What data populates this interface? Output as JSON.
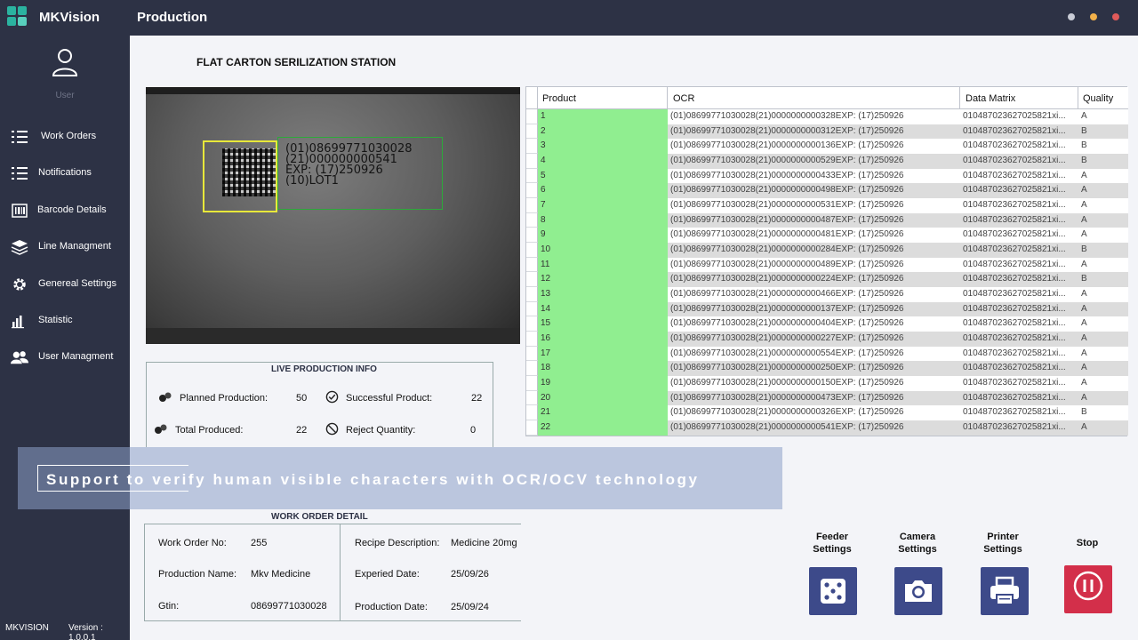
{
  "app": {
    "name": "MKVision",
    "page_title": "Production"
  },
  "window_controls": {
    "colors": [
      "#c9ccd6",
      "#f2b14a",
      "#e05a5a"
    ]
  },
  "sidebar": {
    "user_label": "User",
    "items": [
      {
        "label": "Work Orders",
        "icon": "list-icon"
      },
      {
        "label": "Notifications",
        "icon": "list-icon"
      },
      {
        "label": "Barcode Details",
        "icon": "barcode-icon"
      },
      {
        "label": "Line Managment",
        "icon": "layers-icon"
      },
      {
        "label": "Genereal Settings",
        "icon": "gear-icon"
      },
      {
        "label": "Statistic",
        "icon": "bar-chart-icon"
      },
      {
        "label": "User Managment",
        "icon": "users-icon"
      }
    ],
    "footer_brand": "MKVISION",
    "version": "Version : 1.0.0.1"
  },
  "station_title": "FLAT CARTON SERILIZATION STATION",
  "camera": {
    "lines": [
      "(01)08699771030028",
      "(21)000000000541",
      "EXP: (17)250926",
      "(10)LOT1"
    ]
  },
  "live_info": {
    "title": "LIVE PRODUCTION INFO",
    "planned_label": "Planned Production:",
    "planned_value": "50",
    "successful_label": "Successful Product:",
    "successful_value": "22",
    "total_label": "Total Produced:",
    "total_value": "22",
    "reject_label": "Reject Quantity:",
    "reject_value": "0"
  },
  "banner": {
    "text": "Support to verify human visible characters with OCR/OCV technology"
  },
  "table": {
    "headers": [
      "Product",
      "OCR",
      "Data Matrix",
      "Quality"
    ],
    "rows": [
      {
        "n": "1",
        "ocr": "(01)08699771030028(21)0000000000328EXP: (17)250926",
        "dm": "010487023627025821xi...",
        "q": "A"
      },
      {
        "n": "2",
        "ocr": "(01)08699771030028(21)0000000000312EXP: (17)250926",
        "dm": "010487023627025821xi...",
        "q": "B"
      },
      {
        "n": "3",
        "ocr": "(01)08699771030028(21)0000000000136EXP: (17)250926",
        "dm": "010487023627025821xi...",
        "q": "B"
      },
      {
        "n": "4",
        "ocr": "(01)08699771030028(21)0000000000529EXP: (17)250926",
        "dm": "010487023627025821xi...",
        "q": "B"
      },
      {
        "n": "5",
        "ocr": "(01)08699771030028(21)0000000000433EXP: (17)250926",
        "dm": "010487023627025821xi...",
        "q": "A"
      },
      {
        "n": "6",
        "ocr": "(01)08699771030028(21)0000000000498EXP: (17)250926",
        "dm": "010487023627025821xi...",
        "q": "A"
      },
      {
        "n": "7",
        "ocr": "(01)08699771030028(21)0000000000531EXP: (17)250926",
        "dm": "010487023627025821xi...",
        "q": "A"
      },
      {
        "n": "8",
        "ocr": "(01)08699771030028(21)0000000000487EXP: (17)250926",
        "dm": "010487023627025821xi...",
        "q": "A"
      },
      {
        "n": "9",
        "ocr": "(01)08699771030028(21)0000000000481EXP: (17)250926",
        "dm": "010487023627025821xi...",
        "q": "A"
      },
      {
        "n": "10",
        "ocr": "(01)08699771030028(21)0000000000284EXP: (17)250926",
        "dm": "010487023627025821xi...",
        "q": "B"
      },
      {
        "n": "11",
        "ocr": "(01)08699771030028(21)0000000000489EXP: (17)250926",
        "dm": "010487023627025821xi...",
        "q": "A"
      },
      {
        "n": "12",
        "ocr": "(01)08699771030028(21)0000000000224EXP: (17)250926",
        "dm": "010487023627025821xi...",
        "q": "B"
      },
      {
        "n": "13",
        "ocr": "(01)08699771030028(21)0000000000466EXP: (17)250926",
        "dm": "010487023627025821xi...",
        "q": "A"
      },
      {
        "n": "14",
        "ocr": "(01)08699771030028(21)0000000000137EXP: (17)250926",
        "dm": "010487023627025821xi...",
        "q": "A"
      },
      {
        "n": "15",
        "ocr": "(01)08699771030028(21)0000000000404EXP: (17)250926",
        "dm": "010487023627025821xi...",
        "q": "A"
      },
      {
        "n": "16",
        "ocr": "(01)08699771030028(21)0000000000227EXP: (17)250926",
        "dm": "010487023627025821xi...",
        "q": "A"
      },
      {
        "n": "17",
        "ocr": "(01)08699771030028(21)0000000000554EXP: (17)250926",
        "dm": "010487023627025821xi...",
        "q": "A"
      },
      {
        "n": "18",
        "ocr": "(01)08699771030028(21)0000000000250EXP: (17)250926",
        "dm": "010487023627025821xi...",
        "q": "A"
      },
      {
        "n": "19",
        "ocr": "(01)08699771030028(21)0000000000150EXP: (17)250926",
        "dm": "010487023627025821xi...",
        "q": "A"
      },
      {
        "n": "20",
        "ocr": "(01)08699771030028(21)0000000000473EXP: (17)250926",
        "dm": "010487023627025821xi...",
        "q": "A"
      },
      {
        "n": "21",
        "ocr": "(01)08699771030028(21)0000000000326EXP: (17)250926",
        "dm": "010487023627025821xi...",
        "q": "B"
      },
      {
        "n": "22",
        "ocr": "(01)08699771030028(21)0000000000541EXP: (17)250926",
        "dm": "010487023627025821xi...",
        "q": "A"
      }
    ]
  },
  "work_order": {
    "title": "WORK ORDER DETAIL",
    "wo_no_label": "Work Order No:",
    "wo_no_value": "255",
    "prod_name_label": "Production Name:",
    "prod_name_value": "Mkv Medicine",
    "gtin_label": "Gtin:",
    "gtin_value": "08699771030028",
    "recipe_label": "Recipe Description:",
    "recipe_value": "Medicine 20mg",
    "expired_label": "Experied Date:",
    "expired_value": "25/09/26",
    "production_date_label": "Production Date:",
    "production_date_value": "25/09/24"
  },
  "actions": {
    "feeder": {
      "line1": "Feeder",
      "line2": "Settings",
      "icon": "dice-icon"
    },
    "camera": {
      "line1": "Camera",
      "line2": "Settings",
      "icon": "camera-icon"
    },
    "printer": {
      "line1": "Printer",
      "line2": "Settings",
      "icon": "printer-icon"
    },
    "stop": {
      "label": "Stop",
      "icon": "pause-icon"
    }
  },
  "colors": {
    "accent": "#3d4a8a",
    "stop": "#d32f4a",
    "sidebar": "#2d3245",
    "product_cell": "#90ee90",
    "logo": "#2bb3a0"
  }
}
